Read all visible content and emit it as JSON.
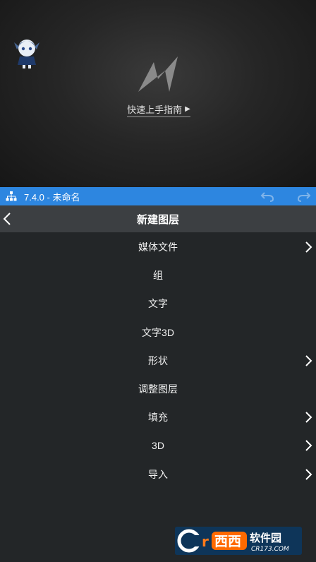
{
  "preview": {
    "guide_label": "快速上手指南",
    "guide_icon": "play-triangle-icon"
  },
  "topbar": {
    "version": "7.4.0 - 未命名",
    "color": "#2d86e0"
  },
  "header": {
    "title": "新建图层"
  },
  "menu": {
    "items": [
      {
        "label": "媒体文件",
        "has_submenu": true
      },
      {
        "label": "组",
        "has_submenu": false
      },
      {
        "label": "文字",
        "has_submenu": false
      },
      {
        "label": "文字3D",
        "has_submenu": false
      },
      {
        "label": "形状",
        "has_submenu": true
      },
      {
        "label": "调整图层",
        "has_submenu": false
      },
      {
        "label": "填充",
        "has_submenu": true
      },
      {
        "label": "3D",
        "has_submenu": true
      },
      {
        "label": "导入",
        "has_submenu": true
      }
    ]
  },
  "watermark": {
    "brand": "西西软件园",
    "site": "CR173.COM"
  }
}
